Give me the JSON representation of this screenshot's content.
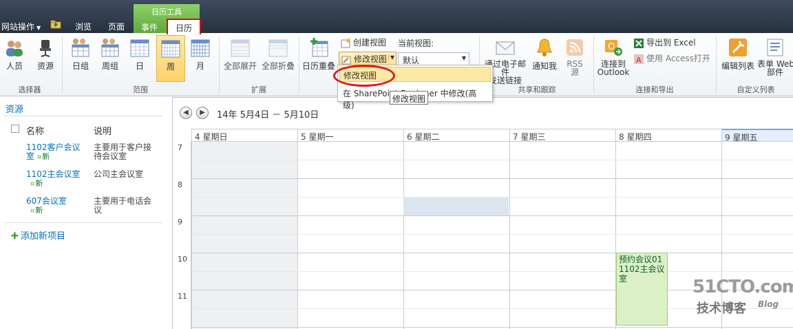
{
  "topbar": {
    "site_actions": "网站操作",
    "tabs": {
      "browse": "浏览",
      "page": "页面"
    },
    "context_group": "日历工具",
    "context_tabs": {
      "events": "事件",
      "calendar": "日历"
    }
  },
  "ribbon": {
    "selector": {
      "label": "选择器",
      "people": "人员",
      "resource": "资源"
    },
    "range": {
      "label": "范围",
      "day_group": "日组",
      "week_group": "周组",
      "day": "日",
      "week": "周",
      "month": "月"
    },
    "expand": {
      "label": "扩展",
      "expand_all": "全部展开",
      "collapse_all": "全部折叠"
    },
    "calendar_overlay": "日历重叠",
    "views": {
      "create_view": "创建视图",
      "modify_view": "修改视图",
      "current_view_label": "当前视图:",
      "current_view_value": "默认"
    },
    "share": {
      "label": "共享和跟踪",
      "email": "通过电子邮件",
      "email_line2": "发送链接",
      "alert": "通知我",
      "rss": "RSS",
      "rss_line2": "源"
    },
    "connect": {
      "label": "连接和导出",
      "outlook": "连接到",
      "outlook_line2": "Outlook",
      "excel": "导出到 Excel",
      "access": "使用 Access打开"
    },
    "custom": {
      "label": "自定义列表",
      "edit_list": "编辑列表",
      "form_web": "表单 Web",
      "form_web_line2": "部件"
    }
  },
  "menu": {
    "item1": "修改视图",
    "item2": "在 SharePoint Designer 中修改(高级)",
    "tooltip": "修改视图"
  },
  "left": {
    "title": "资源",
    "col_name": "名称",
    "col_desc": "说明",
    "resources": [
      {
        "name_l1": "1102客户会议",
        "name_l2": "室",
        "new": "新",
        "desc_l1": "主要用于客户接",
        "desc_l2": "待会议室"
      },
      {
        "name_l1": "1102主会议室",
        "name_l2": "",
        "new": "新",
        "desc_l1": "公司主会议室",
        "desc_l2": ""
      },
      {
        "name_l1": "607会议室",
        "name_l2": "",
        "new": "新",
        "desc_l1": "主要用于电话会",
        "desc_l2": "议"
      }
    ],
    "add_item": "添加新项目"
  },
  "calendar": {
    "range": "14年  5月4日 － 5月10日",
    "days": [
      "4 星期日",
      "5 星期一",
      "6 星期二",
      "7 星期三",
      "8 星期四",
      "9 星期五"
    ],
    "hours": [
      "7",
      "8",
      "9",
      "10",
      "11"
    ],
    "event": {
      "title": "预约会议01",
      "location_l1": "1102主会议",
      "location_l2": "室"
    }
  },
  "watermark": {
    "site": "51CTO.com",
    "sub": "技术博客",
    "blog": "Blog"
  }
}
